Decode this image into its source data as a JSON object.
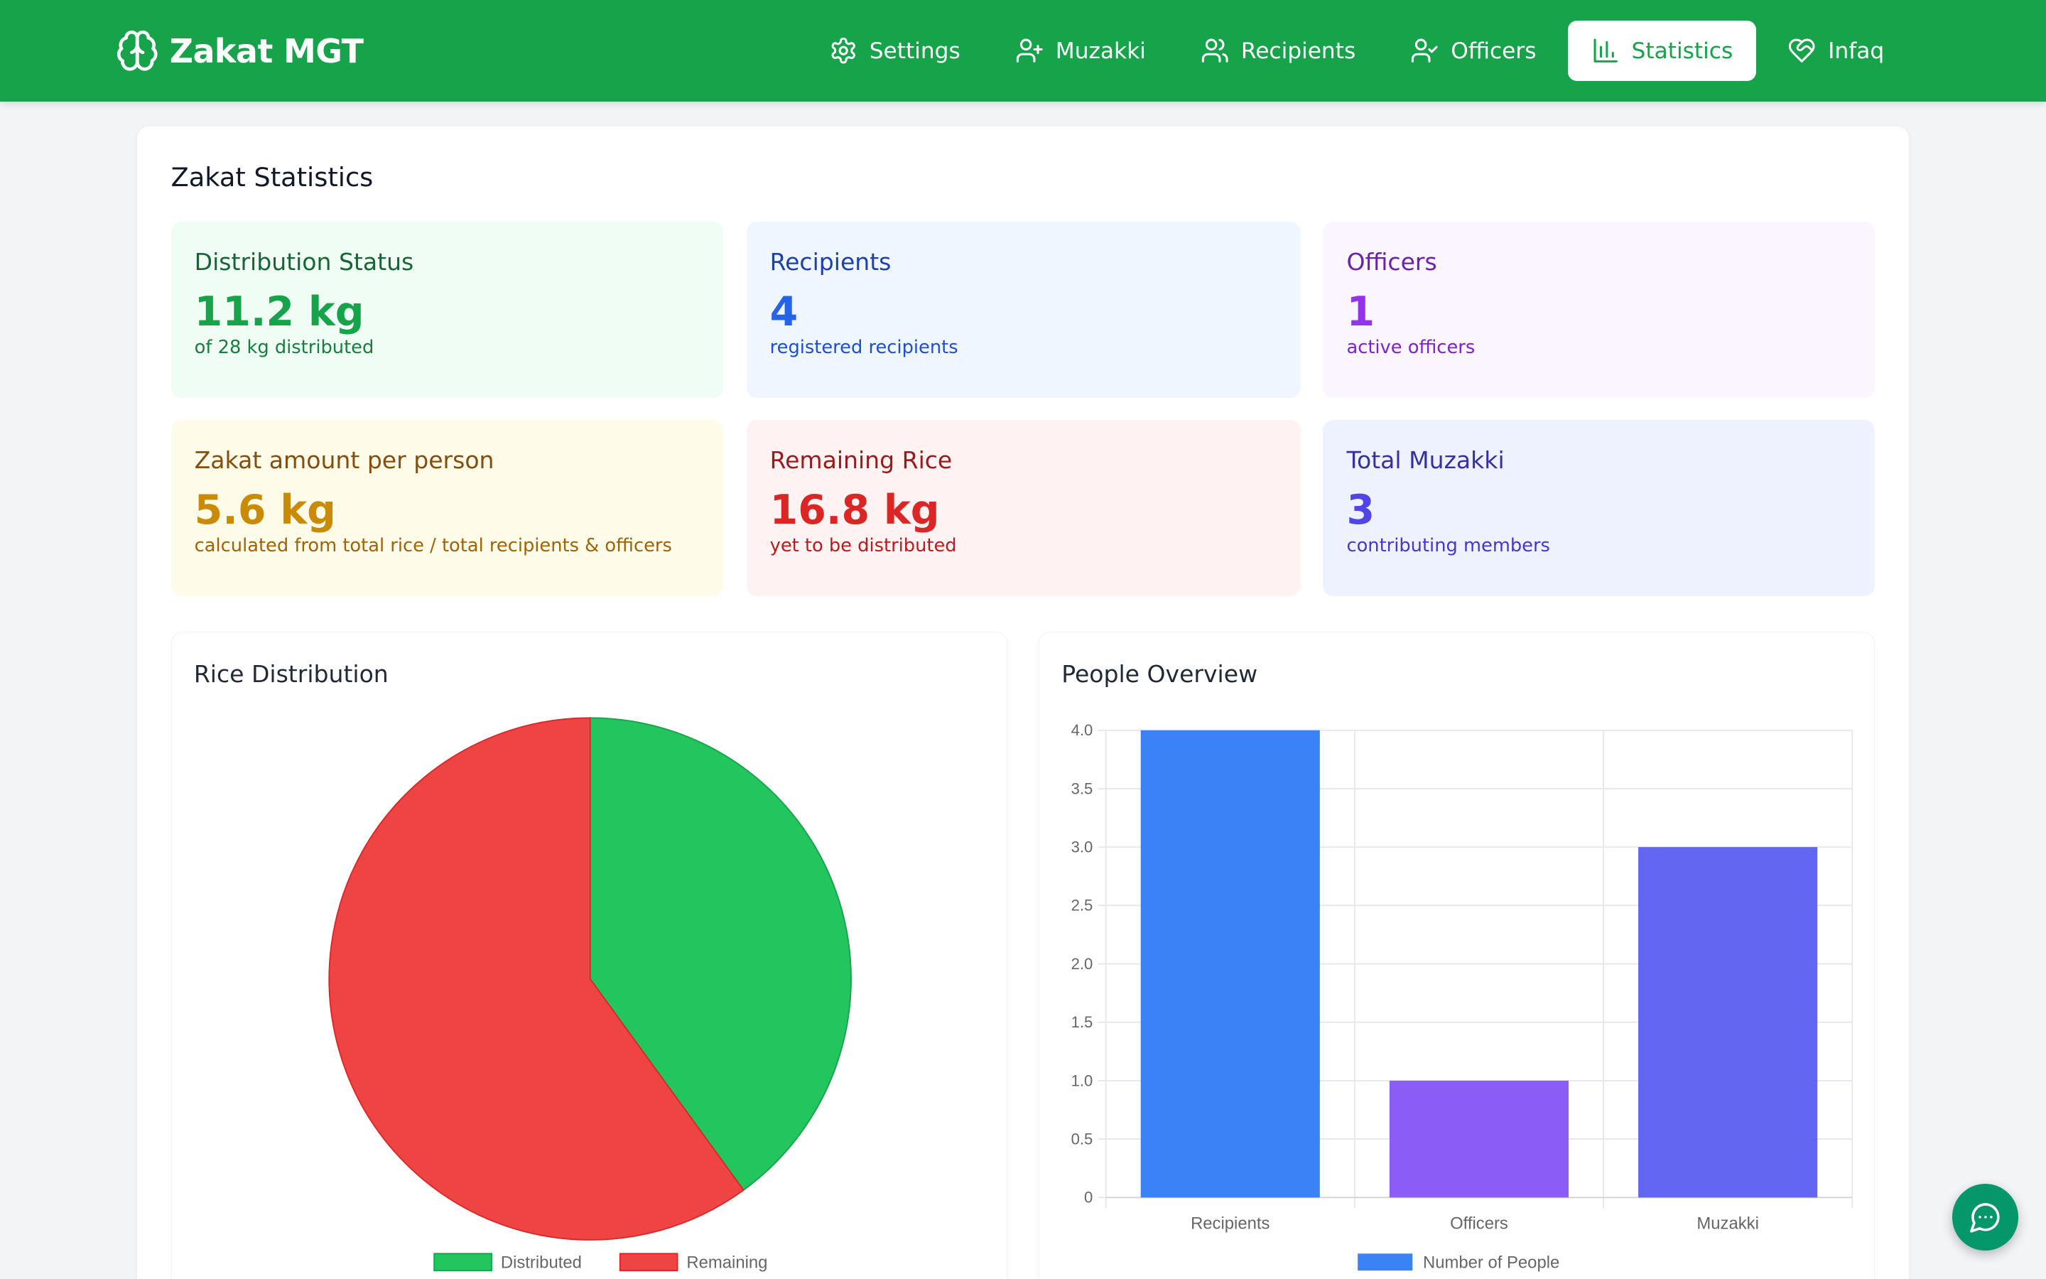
{
  "app": {
    "name": "Zakat MGT"
  },
  "nav": {
    "items": [
      {
        "label": "Settings",
        "icon": "gear-icon",
        "active": false
      },
      {
        "label": "Muzakki",
        "icon": "user-plus-icon",
        "active": false
      },
      {
        "label": "Recipients",
        "icon": "users-icon",
        "active": false
      },
      {
        "label": "Officers",
        "icon": "user-check-icon",
        "active": false
      },
      {
        "label": "Statistics",
        "icon": "bar-chart-icon",
        "active": true
      },
      {
        "label": "Infaq",
        "icon": "heart-handshake-icon",
        "active": false
      }
    ]
  },
  "page": {
    "title": "Zakat Statistics"
  },
  "stats": {
    "distribution": {
      "title": "Distribution Status",
      "value": "11.2 kg",
      "sub": "of 28 kg distributed"
    },
    "recipients": {
      "title": "Recipients",
      "value": "4",
      "sub": "registered recipients"
    },
    "officers": {
      "title": "Officers",
      "value": "1",
      "sub": "active officers"
    },
    "per_person": {
      "title": "Zakat amount per person",
      "value": "5.6 kg",
      "sub": "calculated from total rice / total recipients & officers"
    },
    "remaining": {
      "title": "Remaining Rice",
      "value": "16.8 kg",
      "sub": "yet to be distributed"
    },
    "muzakki": {
      "title": "Total Muzakki",
      "value": "3",
      "sub": "contributing members"
    }
  },
  "colors": {
    "brand": "#16a34a",
    "pie_distributed": "#22c55e",
    "pie_remaining": "#ef4444",
    "bar_recipients": "#3b82f6",
    "bar_officers": "#8b5cf6",
    "bar_muzakki": "#6366f1",
    "chat_button": "#059669"
  },
  "chart_data": [
    {
      "type": "pie",
      "title": "Rice Distribution",
      "labels": [
        "Distributed",
        "Remaining"
      ],
      "values": [
        11.2,
        16.8
      ],
      "legend": "bottom"
    },
    {
      "type": "bar",
      "title": "People Overview",
      "categories": [
        "Recipients",
        "Officers",
        "Muzakki"
      ],
      "series": [
        {
          "name": "Number of People",
          "values": [
            4,
            1,
            3
          ]
        }
      ],
      "ylim": [
        0,
        4
      ],
      "yticks": [
        "0",
        "0.5",
        "1.0",
        "1.5",
        "2.0",
        "2.5",
        "3.0",
        "3.5",
        "4.0"
      ],
      "grid": true,
      "legend": "bottom"
    }
  ],
  "chat": {
    "icon": "chat-icon"
  }
}
